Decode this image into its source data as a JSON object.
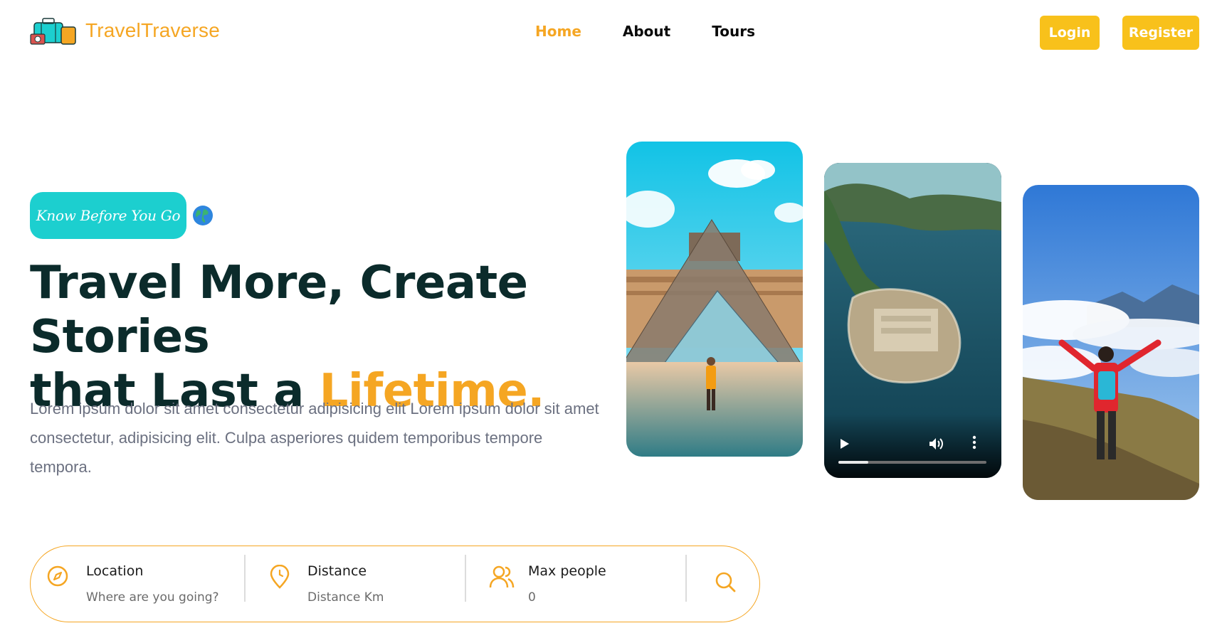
{
  "brand": {
    "name": "TravelTraverse",
    "accent": "#f5a623",
    "button_color": "#f8c11b",
    "teal": "#1ccfcf"
  },
  "nav": {
    "items": [
      {
        "label": "Home",
        "active": true
      },
      {
        "label": "About",
        "active": false
      },
      {
        "label": "Tours",
        "active": false
      }
    ]
  },
  "auth": {
    "login_label": "Login",
    "register_label": "Register"
  },
  "hero": {
    "tagline": "Know Before You Go",
    "title_line1": "Travel More, Create Stories",
    "title_line2_prefix": "that Last a ",
    "title_accent": "Lifetime.",
    "description": "Lorem ipsum dolor sit amet consectetur adipisicing elit Lorem ipsum dolor sit amet consectetur, adipisicing elit. Culpa asperiores quidem temporibus tempore tempora."
  },
  "media": {
    "video_progress": 0.2
  },
  "search": {
    "location": {
      "label": "Location",
      "placeholder": "Where are you going?"
    },
    "distance": {
      "label": "Distance",
      "placeholder": "Distance Km"
    },
    "people": {
      "label": "Max people",
      "placeholder": "0"
    },
    "icons": [
      "compass-icon",
      "map-pin-icon",
      "users-icon",
      "search-icon"
    ]
  }
}
